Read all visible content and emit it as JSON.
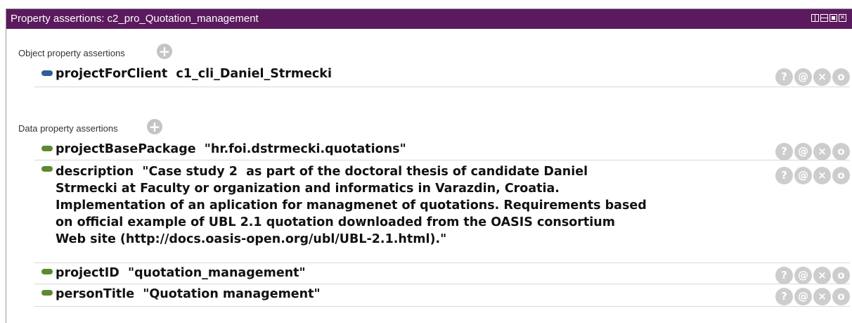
{
  "panel": {
    "title": "Property assertions: c2_pro_Quotation_management"
  },
  "object_section": {
    "label": "Object property assertions",
    "add_glyph": "+",
    "rows": [
      {
        "text": "projectForClient  c1_cli_Daniel_Strmecki",
        "bullet_color": "#2f5f9a"
      }
    ]
  },
  "data_section": {
    "label": "Data property assertions",
    "add_glyph": "+",
    "rows": [
      {
        "text": "projectBasePackage  \"hr.foi.dstrmecki.quotations\"",
        "bullet_color": "#5b8a2f"
      },
      {
        "text": "description  \"Case study 2  as part of the doctoral thesis of candidate Daniel\nStrmecki at Faculty or organization and informatics in Varazdin, Croatia.\nImplementation of an aplication for managmenet of quotations. Requirements based\non official example of UBL 2.1 quotation downloaded from the OASIS consortium\nWeb site (http://docs.oasis-open.org/ubl/UBL-2.1.html).\"",
        "bullet_color": "#5b8a2f"
      },
      {
        "text": "projectID  \"quotation_management\"",
        "bullet_color": "#5b8a2f"
      },
      {
        "text": "personTitle  \"Quotation management\"",
        "bullet_color": "#5b8a2f"
      }
    ]
  },
  "row_actions": {
    "explain": "?",
    "annotate": "@",
    "delete": "×",
    "edit": "o"
  }
}
